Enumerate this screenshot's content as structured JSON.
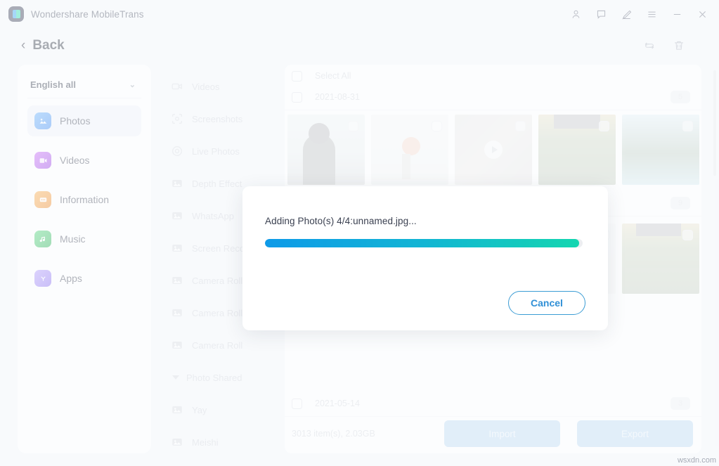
{
  "window": {
    "app_title": "Wondershare MobileTrans",
    "logo_icon": "mobiletrans-logo-icon",
    "controls": [
      {
        "name": "account-icon",
        "glyph": "person"
      },
      {
        "name": "feedback-icon",
        "glyph": "chat"
      },
      {
        "name": "edit-icon",
        "glyph": "pen"
      },
      {
        "name": "menu-icon",
        "glyph": "hamburger"
      },
      {
        "name": "minimize-icon",
        "glyph": "minus"
      },
      {
        "name": "close-icon",
        "glyph": "cross"
      }
    ]
  },
  "subheader": {
    "back_label": "Back",
    "back_chevron": "‹",
    "actions": [
      {
        "name": "refresh-icon"
      },
      {
        "name": "delete-icon"
      }
    ]
  },
  "sidebar": {
    "language_select": {
      "label": "English all",
      "caret": "⌄"
    },
    "items": [
      {
        "label": "Photos",
        "icon": "photos-icon",
        "color": "#2f86f6",
        "active": true
      },
      {
        "label": "Videos",
        "icon": "videos-icon",
        "color": "#a53bf0",
        "active": false
      },
      {
        "label": "Information",
        "icon": "information-icon",
        "color": "#f0901e",
        "active": false
      },
      {
        "label": "Music",
        "icon": "music-icon",
        "color": "#27b850",
        "active": false
      },
      {
        "label": "Apps",
        "icon": "apps-icon",
        "color": "#8a6df0",
        "active": false
      }
    ]
  },
  "albums": {
    "items": [
      {
        "label": "Videos",
        "icon": "video-camera-icon",
        "type": "album"
      },
      {
        "label": "Screenshots",
        "icon": "screenshot-icon",
        "type": "album"
      },
      {
        "label": "Live Photos",
        "icon": "live-photo-icon",
        "type": "album"
      },
      {
        "label": "Depth Effect",
        "icon": "photo-icon",
        "type": "album"
      },
      {
        "label": "WhatsApp",
        "icon": "photo-icon",
        "type": "album"
      },
      {
        "label": "Screen Recorder",
        "icon": "photo-icon",
        "type": "album"
      },
      {
        "label": "Camera Roll",
        "icon": "photo-icon",
        "type": "album"
      },
      {
        "label": "Camera Roll",
        "icon": "photo-icon",
        "type": "album"
      },
      {
        "label": "Camera Roll",
        "icon": "photo-icon",
        "type": "album"
      },
      {
        "label": "Photo Shared",
        "icon": "triangle-down-icon",
        "type": "group"
      },
      {
        "label": "Yay",
        "icon": "photo-icon",
        "type": "album"
      },
      {
        "label": "Meishi",
        "icon": "photo-icon",
        "type": "album"
      }
    ]
  },
  "content": {
    "select_all_label": "Select All",
    "sections": [
      {
        "date": "2021-08-31",
        "count": "5",
        "thumbs": [
          {
            "name": "photo-person",
            "art": "img-person",
            "video": false
          },
          {
            "name": "photo-flowers",
            "art": "img-flowers",
            "video": false
          },
          {
            "name": "video-clip-1",
            "art": "img-video1",
            "video": true
          },
          {
            "name": "photo-plants",
            "art": "img-plants",
            "video": false
          },
          {
            "name": "photo-palms",
            "art": "img-palms",
            "video": false
          }
        ]
      },
      {
        "date": "",
        "count": "9",
        "thumbs": [
          {
            "name": "photo-art",
            "art": "img-art",
            "video": false
          },
          {
            "name": "photo-chart",
            "art": "img-chart",
            "video": false
          },
          {
            "name": "video-clip-2",
            "art": "img-video2",
            "video": true
          },
          {
            "name": "photo-cable",
            "art": "img-cable",
            "video": false
          },
          {
            "name": "photo-plants-2",
            "art": "img-plants2",
            "video": false
          }
        ]
      },
      {
        "date": "2021-05-14",
        "count": "3",
        "thumbs": []
      }
    ]
  },
  "footer": {
    "info": "3013 item(s), 2.03GB",
    "import_label": "Import",
    "export_label": "Export"
  },
  "modal": {
    "message": "Adding Photo(s) 4/4:unnamed.jpg...",
    "progress_percent": 99,
    "cancel_label": "Cancel",
    "gradient_start": "#0e9ae8",
    "gradient_end": "#14d6b0"
  },
  "watermark": {
    "text": "wsxdn.com"
  }
}
